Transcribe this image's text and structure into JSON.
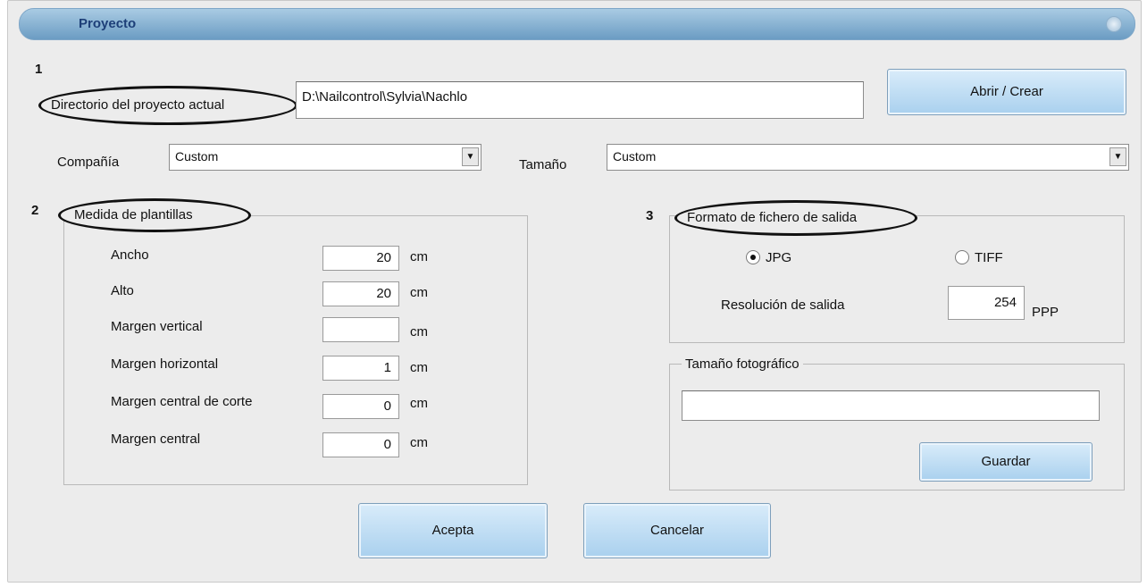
{
  "window": {
    "title": "Proyecto"
  },
  "section_numbers": {
    "one": "1",
    "two": "2",
    "three": "3"
  },
  "project_dir": {
    "label": "Directorio del proyecto actual",
    "value": "D:\\Nailcontrol\\Sylvia\\Nachlo",
    "open_button": "Abrir / Crear"
  },
  "company": {
    "label": "Compañía",
    "value": "Custom"
  },
  "size": {
    "label": "Tamaño",
    "value": "Custom"
  },
  "template": {
    "title": "Medida de plantillas",
    "fields": [
      {
        "label": "Ancho",
        "value": "20",
        "unit": "cm"
      },
      {
        "label": "Alto",
        "value": "20",
        "unit": "cm"
      },
      {
        "label": "Margen vertical",
        "value": "",
        "unit": "cm"
      },
      {
        "label": "Margen horizontal",
        "value": "1",
        "unit": "cm"
      },
      {
        "label": "Margen central de corte",
        "value": "0",
        "unit": "cm"
      },
      {
        "label": "Margen central",
        "value": "0",
        "unit": "cm"
      }
    ]
  },
  "output": {
    "title": "Formato de fichero de salida",
    "jpg_label": "JPG",
    "tiff_label": "TIFF",
    "selected": "JPG",
    "resolution_label": "Resolución de salida",
    "resolution_value": "254",
    "resolution_unit": "PPP"
  },
  "photo_size": {
    "title": "Tamaño fotográfico",
    "value": "",
    "save_button": "Guardar"
  },
  "footer": {
    "accept": "Acepta",
    "cancel": "Cancelar"
  },
  "colors": {
    "titlebar": "#6b9cc3",
    "button": "#a9d0ee",
    "background": "#ececec"
  }
}
